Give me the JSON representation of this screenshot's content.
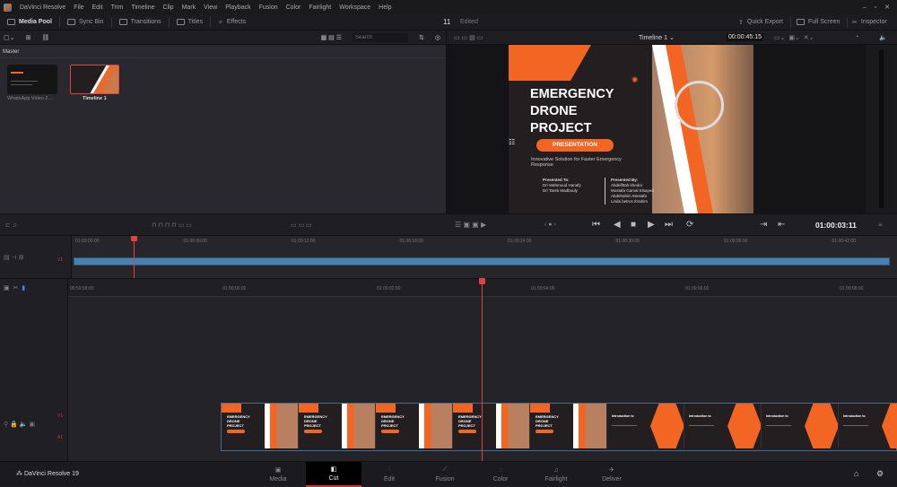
{
  "app": {
    "title": "DaVinci Resolve",
    "menu": [
      "File",
      "Edit",
      "Trim",
      "Timeline",
      "Clip",
      "Mark",
      "View",
      "Playback",
      "Fusion",
      "Color",
      "Fairlight",
      "Workspace",
      "Help"
    ]
  },
  "toolbar": {
    "items": [
      "Media Pool",
      "Sync Bin",
      "Transitions",
      "Titles",
      "Effects"
    ],
    "project_count": "11",
    "project_status": "Edited",
    "quick_export": "Quick Export",
    "full_screen": "Full Screen",
    "inspector": "Inspector"
  },
  "media_pool": {
    "search_placeholder": "Search",
    "bin": "Master",
    "clips": [
      {
        "name": "WhatsApp Video 2..."
      },
      {
        "name": "Timeline 1"
      }
    ]
  },
  "viewer": {
    "timeline_name": "Timeline 1",
    "duration": "00:00:45:15",
    "timecode": "01:00:03:11"
  },
  "slide": {
    "title_lines": [
      "EMERGENCY",
      "DRONE",
      "PROJECT"
    ],
    "badge": "PRESENTATION",
    "subtitle": "Innovative Solution for Faster Emergency Response",
    "presented_to_label": "Presented To:",
    "presented_to": [
      "Dr/ Mahmoud Hanafy",
      "Dr/ Tarek Madbouly"
    ],
    "presented_by_label": "Presented By:",
    "presented_by": [
      "Abdelfttah khedor",
      "Mostafa Gamal Elsayed",
      "Abdelrahim Mostafa",
      "Linda betros Ibrahim"
    ]
  },
  "upper_ruler": [
    "01:00:00:00",
    "01:00:06:00",
    "01:00:12:00",
    "01:00:18:00",
    "01:00:24:00",
    "01:00:30:00",
    "01:00:36:00",
    "01:00:42:00"
  ],
  "lower_ruler": [
    "00:59:58:00",
    "01:00:00:00",
    "01:00:02:00",
    "01:00:04:00",
    "01:00:06:00",
    "01:00:08:00"
  ],
  "tracks": {
    "v1": "V1",
    "a1": "A1"
  },
  "thumb_intro": "Introduction to",
  "pages": [
    "Media",
    "Cut",
    "Edit",
    "Fusion",
    "Color",
    "Fairlight",
    "Deliver"
  ],
  "active_page": "Cut",
  "brand": "DaVinci Resolve 19",
  "colors": {
    "accent": "#f26522",
    "playhead": "#e0413a",
    "clip_blue": "#4a7fb0"
  }
}
